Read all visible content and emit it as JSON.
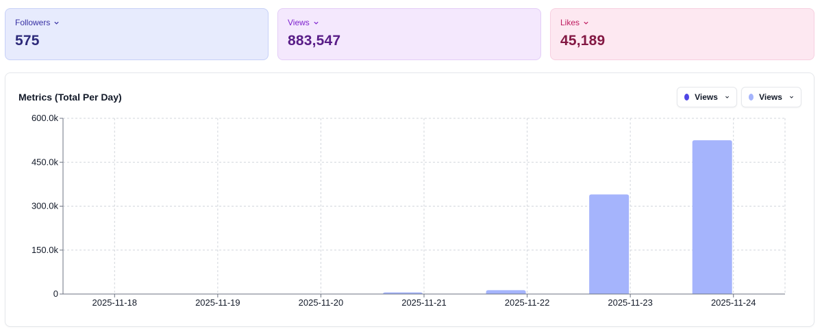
{
  "stats": {
    "followers": {
      "label": "Followers",
      "value": "575"
    },
    "views": {
      "label": "Views",
      "value": "883,547"
    },
    "likes": {
      "label": "Likes",
      "value": "45,189"
    }
  },
  "chart_panel": {
    "title": "Metrics (Total Per Day)",
    "selectors": [
      {
        "label": "Views",
        "color": "#4f46e5"
      },
      {
        "label": "Views",
        "color": "#a5b4fc"
      }
    ]
  },
  "chart_data": {
    "type": "bar",
    "title": "Metrics (Total Per Day)",
    "categories": [
      "2025-11-18",
      "2025-11-19",
      "2025-11-20",
      "2025-11-21",
      "2025-11-22",
      "2025-11-23",
      "2025-11-24"
    ],
    "series": [
      {
        "name": "Views",
        "color": "#a5b4fc",
        "values": [
          0,
          0,
          0,
          5500,
          13000,
          340000,
          525000
        ]
      }
    ],
    "y_ticks": [
      0,
      150000,
      300000,
      450000,
      600000
    ],
    "y_tick_labels": [
      "0",
      "150.0k",
      "300.0k",
      "450.0k",
      "600.0k"
    ],
    "ylim": [
      0,
      600000
    ],
    "grid": true,
    "bar_color": "#a5b4fc"
  }
}
